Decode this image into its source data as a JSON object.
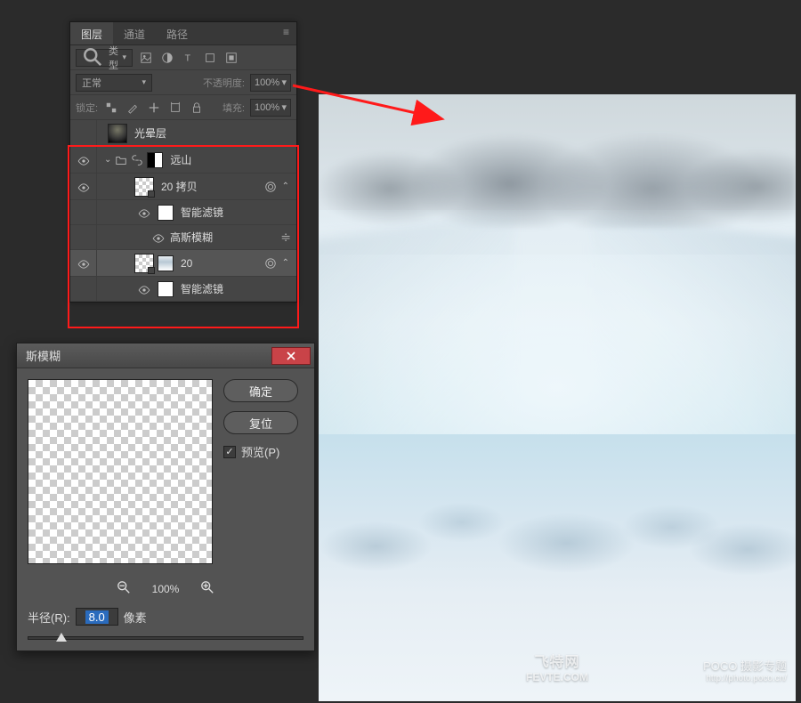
{
  "panel": {
    "tabs": {
      "layers": "图层",
      "channels": "通道",
      "paths": "路径"
    },
    "filter_type": "类型",
    "blend_mode": "正常",
    "opacity_label": "不透明度:",
    "opacity_value": "100%",
    "lock_label": "锁定:",
    "fill_label": "填充:",
    "fill_value": "100%"
  },
  "layers": {
    "halo": "光晕层",
    "far_mountain_group": "远山",
    "copy20": "20 拷贝",
    "smart_filters": "智能滤镜",
    "gaussian_blur": "高斯模糊",
    "layer20": "20",
    "smart_filters2": "智能滤镜"
  },
  "dialog": {
    "title": "斯模糊",
    "ok": "确定",
    "reset": "复位",
    "preview": "预览(P)",
    "zoom": "100%",
    "radius_label": "半径(R):",
    "radius_value": "8.0",
    "radius_unit": "像素"
  },
  "watermark": {
    "center_line1": "飞特网",
    "center_line2": "FEVTE.COM",
    "right_line1": "POCO 摄影专题",
    "right_line2": "http://photo.poco.cn/"
  }
}
